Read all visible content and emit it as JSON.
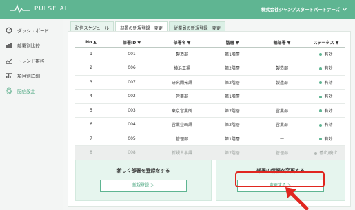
{
  "header": {
    "brand": "PULSE AI",
    "company": "株式会社ジャンプスタートパートナーズ",
    "dropdown_icon": "chevron-down-icon"
  },
  "sidebar": {
    "items": [
      {
        "label": "ダッシュボード",
        "icon": "dashboard-icon"
      },
      {
        "label": "部署別比較",
        "icon": "bar-chart-icon"
      },
      {
        "label": "トレンド推移",
        "icon": "trend-icon"
      },
      {
        "label": "項目別詳細",
        "icon": "detail-icon"
      },
      {
        "label": "配信設定",
        "icon": "gear-icon",
        "active": true
      }
    ]
  },
  "tabs": [
    "配信スケジュール",
    "部署の新規登録・変更",
    "従業員の新規登録・変更"
  ],
  "table": {
    "headers": [
      "No ▲",
      "部署ID ▼",
      "部署名 ▼",
      "階層 ▼",
      "親部署 ▼",
      "ステータス ▼"
    ],
    "rows": [
      {
        "no": "1",
        "id": "001",
        "name": "製造部",
        "level": "第1階層",
        "parent": "—",
        "status": "有効"
      },
      {
        "no": "2",
        "id": "006",
        "name": "横浜工場",
        "level": "第2階層",
        "parent": "製造部",
        "status": "有効"
      },
      {
        "no": "3",
        "id": "007",
        "name": "研究開発課",
        "level": "第2階層",
        "parent": "製造部",
        "status": "有効"
      },
      {
        "no": "4",
        "id": "002",
        "name": "営業部",
        "level": "第1階層",
        "parent": "—",
        "status": "有効"
      },
      {
        "no": "5",
        "id": "003",
        "name": "東京営業所",
        "level": "第2階層",
        "parent": "営業部",
        "status": "有効"
      },
      {
        "no": "6",
        "id": "004",
        "name": "営業企画課",
        "level": "第2階層",
        "parent": "営業部",
        "status": "有効"
      },
      {
        "no": "7",
        "id": "005",
        "name": "管理部",
        "level": "第1階層",
        "parent": "—",
        "status": "有効"
      },
      {
        "no": "8",
        "id": "008",
        "name": "新規人事課",
        "level": "第2階層",
        "parent": "管理部",
        "status": "停止/廃止",
        "disabled": true
      }
    ]
  },
  "cards": {
    "new": {
      "title": "新しく部署を登録をする",
      "button": "新規登録 ＞"
    },
    "change": {
      "title": "部署の情報を変更する",
      "button": "変更する ＞"
    }
  },
  "colors": {
    "accent": "#5fb592",
    "highlight": "#e0261f"
  }
}
